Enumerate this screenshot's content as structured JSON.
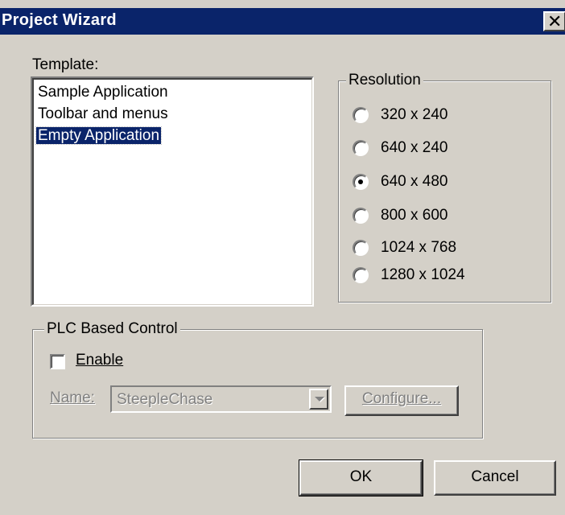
{
  "window": {
    "title": "Project Wizard",
    "close_glyph": "✕"
  },
  "template": {
    "label": "Template:",
    "items": [
      {
        "label": "Sample Application",
        "selected": false
      },
      {
        "label": "Toolbar and menus",
        "selected": false
      },
      {
        "label": "Empty Application",
        "selected": true
      }
    ]
  },
  "resolution": {
    "legend": "Resolution",
    "selected": "640 x 480",
    "options": [
      {
        "label": "320 x 240",
        "checked": false
      },
      {
        "label": "640 x 240",
        "checked": false
      },
      {
        "label": "640 x 480",
        "checked": true
      },
      {
        "label": "800 x 600",
        "checked": false
      },
      {
        "label": "1024 x 768",
        "checked": false
      },
      {
        "label": "1280 x 1024",
        "checked": false
      }
    ]
  },
  "plc": {
    "legend": "PLC Based Control",
    "enable_label": "Enable",
    "enable_checked": false,
    "name_label": "Name:",
    "name_value": "SteepleChase",
    "configure_label": "Configure..."
  },
  "buttons": {
    "ok": "OK",
    "cancel": "Cancel"
  },
  "colors": {
    "title_bar": "#0a246a",
    "face": "#d4d0c8",
    "selection": "#0a246a"
  }
}
